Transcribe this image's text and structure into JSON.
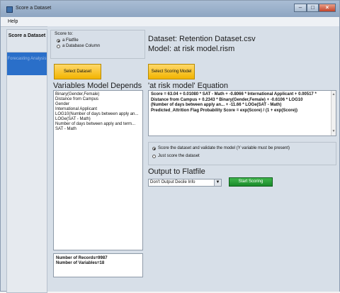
{
  "window": {
    "title": "Score a Dataset"
  },
  "menu": {
    "help_label": "Help"
  },
  "nav": {
    "score_dataset_label": "Score a Dataset",
    "forecasting_label": "Forecasting Analysis"
  },
  "score_to": {
    "label": "Score to:",
    "options": [
      "a Flatfile",
      "a Database Column"
    ],
    "selected": "a Flatfile"
  },
  "dataset": {
    "label": "Dataset: Retention Dataset.csv",
    "model_label": "Model: at risk model.rism"
  },
  "buttons": {
    "select_dataset": "Select Dataset",
    "select_scoring_model": "Select Scoring Model",
    "start_scoring": "Start Scoring"
  },
  "variables": {
    "heading": "Variables Model Depends",
    "items": [
      "Binary(Gender,Female)",
      "Distance from Campus",
      "Gender",
      "International Applicant",
      "LOG10(Number of days between apply an...",
      "LOGe(SAT - Math)",
      "Number of days between apply and term...",
      "SAT - Math"
    ]
  },
  "equation": {
    "heading": "'at risk model' Equation",
    "lines": [
      "Score = 63.04 + 0.01080 * SAT - Math + -0.8066 * International Applicant + 0.00517 *",
      "Distance from Campus + 0.2343 * Binary(Gender,Female) + -0.6106 * LOG10",
      "(Number of days between apply an... + -11.66 * LOGe(SAT - Math)",
      "Predicted_Attrition Flag Probability Score = exp(Score) / (1 + exp(Score))"
    ]
  },
  "score_options": {
    "option1": "Score the dataset and validate the model (Y variable must be present)",
    "option2": "Just score the dataset",
    "selected": "option1"
  },
  "output": {
    "heading": "Output to Flatfile",
    "dropdown_value": "Don't Output Decile Info"
  },
  "stats": {
    "records": "Number of Records=9987",
    "variables": "Number of Variables=18"
  }
}
